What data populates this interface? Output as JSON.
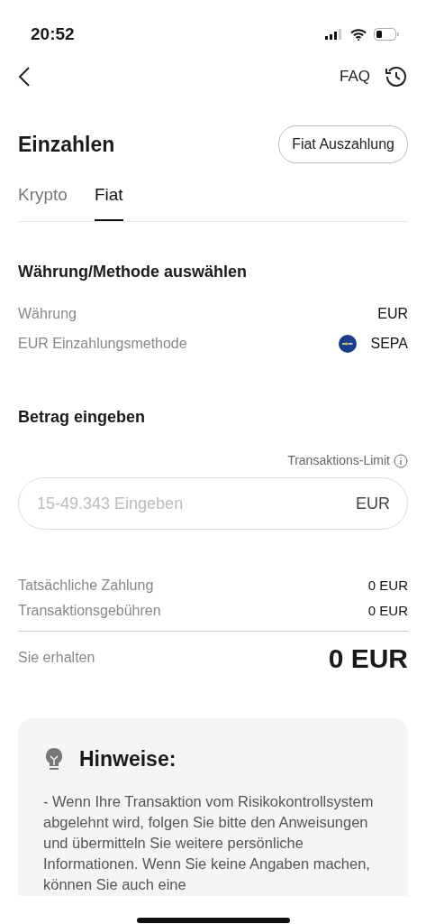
{
  "status_bar": {
    "time": "20:52"
  },
  "nav": {
    "faq": "FAQ"
  },
  "header": {
    "title": "Einzahlen",
    "button": "Fiat Auszahlung"
  },
  "tabs": [
    {
      "label": "Krypto",
      "selected": false
    },
    {
      "label": "Fiat",
      "selected": true
    }
  ],
  "method_section": {
    "title": "Währung/Methode auswählen",
    "rows": [
      {
        "label": "Währung",
        "value": "EUR",
        "kind": "plain"
      },
      {
        "label": "EUR Einzahlungsmethode",
        "value": "SEPA",
        "kind": "sepa"
      }
    ]
  },
  "amount_section": {
    "title": "Betrag eingeben",
    "limit": "Transaktions-Limit",
    "placeholder": "15-49.343 Eingeben",
    "currency": "EUR"
  },
  "summary": {
    "rows": [
      {
        "label": "Tatsächliche Zahlung",
        "value": "0 EUR"
      },
      {
        "label": "Transaktionsgebühren",
        "value": "0 EUR"
      }
    ],
    "receive_label": "Sie erhalten",
    "receive_value": "0 EUR"
  },
  "notes": {
    "title": "Hinweise:",
    "text": "- Wenn Ihre Transaktion vom Risikokontrollsystem abgelehnt wird, folgen Sie bitte den Anweisungen und übermitteln Sie weitere persönliche Informationen. Wenn Sie keine Angaben machen, können Sie auch eine"
  }
}
